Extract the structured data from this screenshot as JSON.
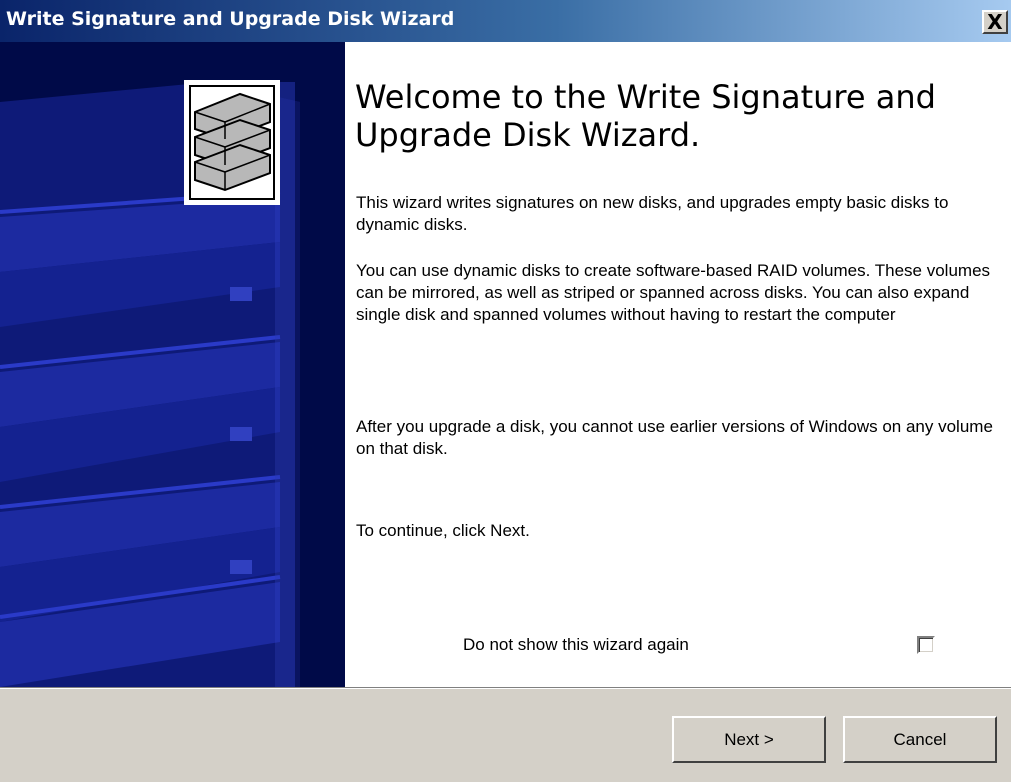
{
  "window": {
    "title": "Write Signature and Upgrade Disk Wizard",
    "close_glyph": "X"
  },
  "wizard": {
    "heading": "Welcome to the Write Signature and Upgrade Disk Wizard.",
    "paragraph1": "This wizard writes signatures on new disks, and upgrades empty basic disks to dynamic disks.",
    "paragraph2": "You can use dynamic disks to create software-based RAID volumes.  These volumes can be mirrored, as well as striped or spanned across disks. You can also expand single disk and spanned volumes without having to restart the computer",
    "paragraph3": "After you upgrade a disk, you cannot use earlier versions of Windows on any volume on that disk.",
    "paragraph4": "To continue, click Next.",
    "checkbox_label": "Do not show this wizard again",
    "checkbox_checked": false,
    "banner_icon": "disk-stack-icon"
  },
  "buttons": {
    "next": "Next >",
    "cancel": "Cancel"
  },
  "colors": {
    "title_gradient_start": "#0a246a",
    "banner_background": "#000840",
    "dialog_face": "#d4d0c8"
  }
}
